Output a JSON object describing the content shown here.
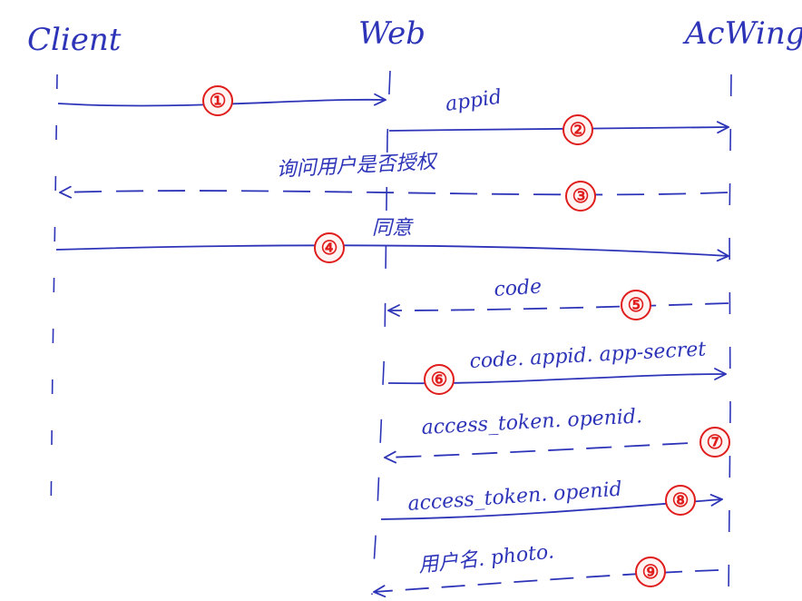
{
  "colors": {
    "ink": "#2d34b8",
    "badge_stroke": "#e01d1d",
    "badge_fill": "#fff4f2",
    "paper": "#ffffff"
  },
  "actors": {
    "client": "Client",
    "web": "Web",
    "acwing": "AcWing"
  },
  "steps": [
    {
      "num": "①",
      "label": "",
      "from": "client",
      "to": "web",
      "style": "solid"
    },
    {
      "num": "②",
      "label": "appid",
      "from": "web",
      "to": "acwing",
      "style": "solid"
    },
    {
      "num": "③",
      "label": "询问用户是否授权",
      "from": "acwing",
      "to": "client",
      "style": "dashed"
    },
    {
      "num": "④",
      "label": "同意",
      "from": "client",
      "to": "acwing",
      "style": "solid"
    },
    {
      "num": "⑤",
      "label": "code",
      "from": "acwing",
      "to": "web",
      "style": "dashed"
    },
    {
      "num": "⑥",
      "label": "code. appid. app-secret",
      "from": "web",
      "to": "acwing",
      "style": "solid"
    },
    {
      "num": "⑦",
      "label": "access_token. openid.",
      "from": "acwing",
      "to": "web",
      "style": "dashed"
    },
    {
      "num": "⑧",
      "label": "access_token. openid",
      "from": "web",
      "to": "acwing",
      "style": "solid"
    },
    {
      "num": "⑨",
      "label": "用户名. photo.",
      "from": "acwing",
      "to": "web",
      "style": "dashed"
    }
  ]
}
